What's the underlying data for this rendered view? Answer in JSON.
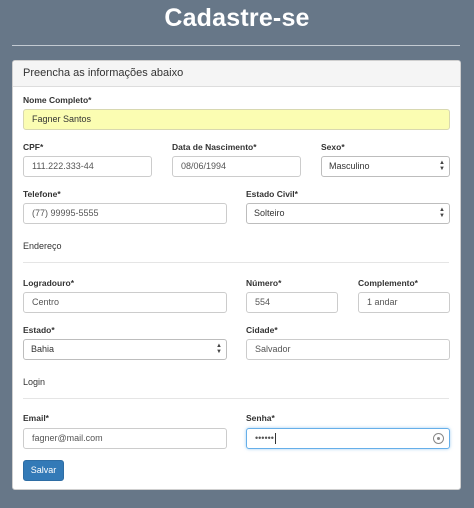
{
  "page": {
    "title": "Cadastre-se"
  },
  "panel": {
    "heading": "Preencha as informações abaixo"
  },
  "form": {
    "nome": {
      "label": "Nome Completo*",
      "value": "Fagner Santos"
    },
    "cpf": {
      "label": "CPF*",
      "value": "111.222.333-44"
    },
    "nascimento": {
      "label": "Data de Nascimento*",
      "value": "08/06/1994"
    },
    "sexo": {
      "label": "Sexo*",
      "value": "Masculino"
    },
    "telefone": {
      "label": "Telefone*",
      "value": "(77) 99995-5555"
    },
    "estado_civil": {
      "label": "Estado Civil*",
      "value": "Solteiro"
    },
    "endereco_section": "Endereço",
    "logradouro": {
      "label": "Logradouro*",
      "value": "Centro"
    },
    "numero": {
      "label": "Número*",
      "value": "554"
    },
    "complemento": {
      "label": "Complemento*",
      "value": "1 andar"
    },
    "estado": {
      "label": "Estado*",
      "value": "Bahia"
    },
    "cidade": {
      "label": "Cidade*",
      "value": "Salvador"
    },
    "login_section": "Login",
    "email": {
      "label": "Email*",
      "value": "fagner@mail.com"
    },
    "senha": {
      "label": "Senha*",
      "value": "••••••"
    },
    "submit_label": "Salvar"
  },
  "colors": {
    "background": "#677788",
    "button": "#337ab7",
    "autofill": "#fbfdb2"
  }
}
